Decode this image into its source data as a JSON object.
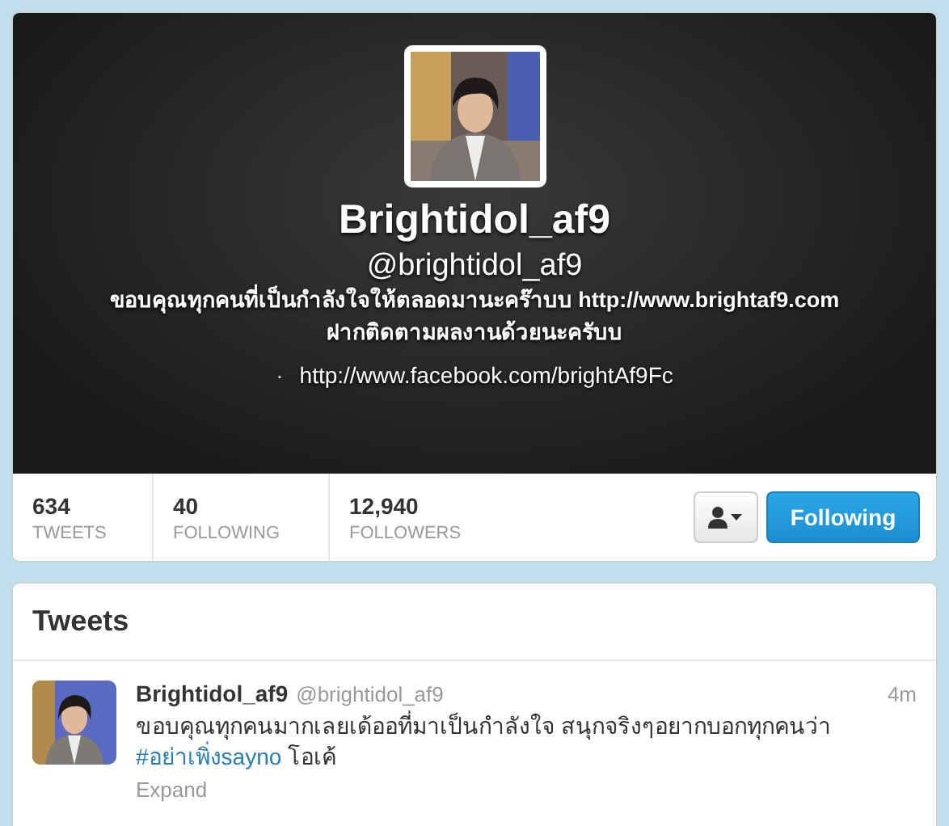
{
  "profile": {
    "name": "Brightidol_af9",
    "handle": "@brightidol_af9",
    "bio_lines": [
      "ขอบคุณทุกคนที่เป็นกำลังใจให้ตลอดมานะคร๊าบบ http://www.brightaf9.com",
      "ฝากติดตามผลงานด้วยนะครับบ"
    ],
    "separator": "·",
    "url": "http://www.facebook.com/brightAf9Fc"
  },
  "stats": [
    {
      "value": "634",
      "label": "TWEETS"
    },
    {
      "value": "40",
      "label": "FOLLOWING"
    },
    {
      "value": "12,940",
      "label": "FOLLOWERS"
    }
  ],
  "follow_button": {
    "label": "Following"
  },
  "tweets": {
    "title": "Tweets",
    "items": [
      {
        "name": "Brightidol_af9",
        "handle": "@brightidol_af9",
        "time": "4m",
        "parts": [
          {
            "kind": "plain",
            "text": "ขอบคุณทุกคนมากเลยเด้ออที่มาเป็นกำลังใจ สนุกจริงๆอยากบอกทุกคนว่า "
          },
          {
            "kind": "hashtag",
            "text": "#อย่าเพิ่งsayno"
          },
          {
            "kind": "plain",
            "text": " โอเค้"
          }
        ],
        "expand": "Expand"
      }
    ]
  }
}
